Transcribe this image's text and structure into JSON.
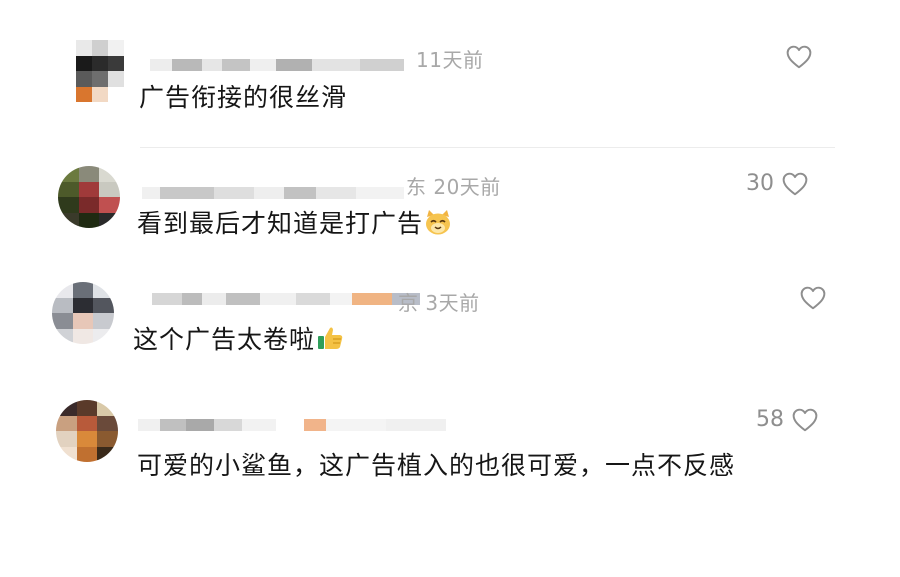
{
  "comments": [
    {
      "meta": "11天前",
      "text": "广告衔接的很丝滑",
      "likes": ""
    },
    {
      "meta": "东 20天前",
      "text": "看到最后才知道是打广告",
      "emoji": "cat-face",
      "likes": "30"
    },
    {
      "meta": "京 3天前",
      "text": "这个广告太卷啦",
      "emoji": "thumbs-up",
      "likes": ""
    },
    {
      "meta": "",
      "text": "可爱的小鲨鱼，这广告植入的也很可爱，一点不反感",
      "likes": "58"
    }
  ],
  "colors": {
    "text": "#161616",
    "meta": "#a8a8a8",
    "icon": "#8e8e8e"
  }
}
